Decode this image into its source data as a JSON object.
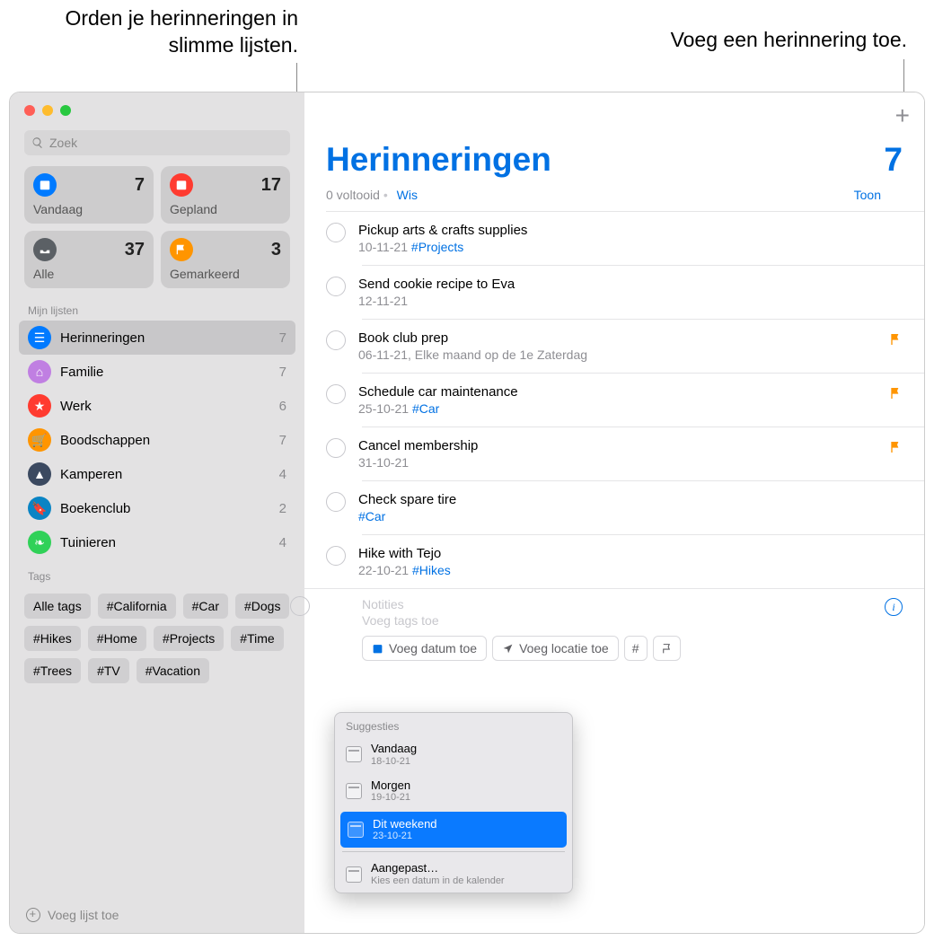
{
  "callouts": {
    "left": "Orden je herinneringen in slimme lijsten.",
    "right": "Voeg een herinnering toe."
  },
  "search": {
    "placeholder": "Zoek"
  },
  "smartlists": {
    "today": {
      "label": "Vandaag",
      "count": 7
    },
    "planned": {
      "label": "Gepland",
      "count": 17
    },
    "all": {
      "label": "Alle",
      "count": 37
    },
    "flagged": {
      "label": "Gemarkeerd",
      "count": 3
    }
  },
  "sidebar": {
    "mylists_label": "Mijn lijsten",
    "lists": [
      {
        "name": "Herinneringen",
        "count": 7,
        "color": "l-blue",
        "selected": true
      },
      {
        "name": "Familie",
        "count": 7,
        "color": "l-purple"
      },
      {
        "name": "Werk",
        "count": 6,
        "color": "l-red"
      },
      {
        "name": "Boodschappen",
        "count": 7,
        "color": "l-orange"
      },
      {
        "name": "Kamperen",
        "count": 4,
        "color": "l-navy"
      },
      {
        "name": "Boekenclub",
        "count": 2,
        "color": "l-teal"
      },
      {
        "name": "Tuinieren",
        "count": 4,
        "color": "l-green"
      }
    ],
    "tags_label": "Tags",
    "tags": [
      "Alle tags",
      "#California",
      "#Car",
      "#Dogs",
      "#Hikes",
      "#Home",
      "#Projects",
      "#Time",
      "#Trees",
      "#TV",
      "#Vacation"
    ],
    "add_list": "Voeg lijst toe"
  },
  "main": {
    "title": "Herinneringen",
    "count": 7,
    "completed": "0 voltooid",
    "clear": "Wis",
    "show": "Toon",
    "reminders": [
      {
        "title": "Pickup arts & crafts supplies",
        "date": "10-11-21",
        "tag": "#Projects"
      },
      {
        "title": "Send cookie recipe to Eva",
        "date": "12-11-21"
      },
      {
        "title": "Book club prep",
        "date": "06-11-21, Elke maand op de 1e Zaterdag",
        "flagged": true
      },
      {
        "title": "Schedule car maintenance",
        "date": "25-10-21",
        "tag": "#Car",
        "flagged": true
      },
      {
        "title": "Cancel membership",
        "date": "31-10-21",
        "flagged": true
      },
      {
        "title": "Check spare tire",
        "tag": "#Car"
      },
      {
        "title": "Hike with Tejo",
        "date": "22-10-21",
        "tag": "#Hikes"
      }
    ],
    "new": {
      "notes_placeholder": "Notities",
      "tags_placeholder": "Voeg tags toe",
      "add_date": "Voeg datum toe",
      "add_location": "Voeg locatie toe"
    },
    "suggestions": {
      "header": "Suggesties",
      "items": [
        {
          "label": "Vandaag",
          "sub": "18-10-21"
        },
        {
          "label": "Morgen",
          "sub": "19-10-21"
        },
        {
          "label": "Dit weekend",
          "sub": "23-10-21",
          "selected": true
        }
      ],
      "custom": {
        "label": "Aangepast…",
        "sub": "Kies een datum in de kalender"
      }
    }
  }
}
